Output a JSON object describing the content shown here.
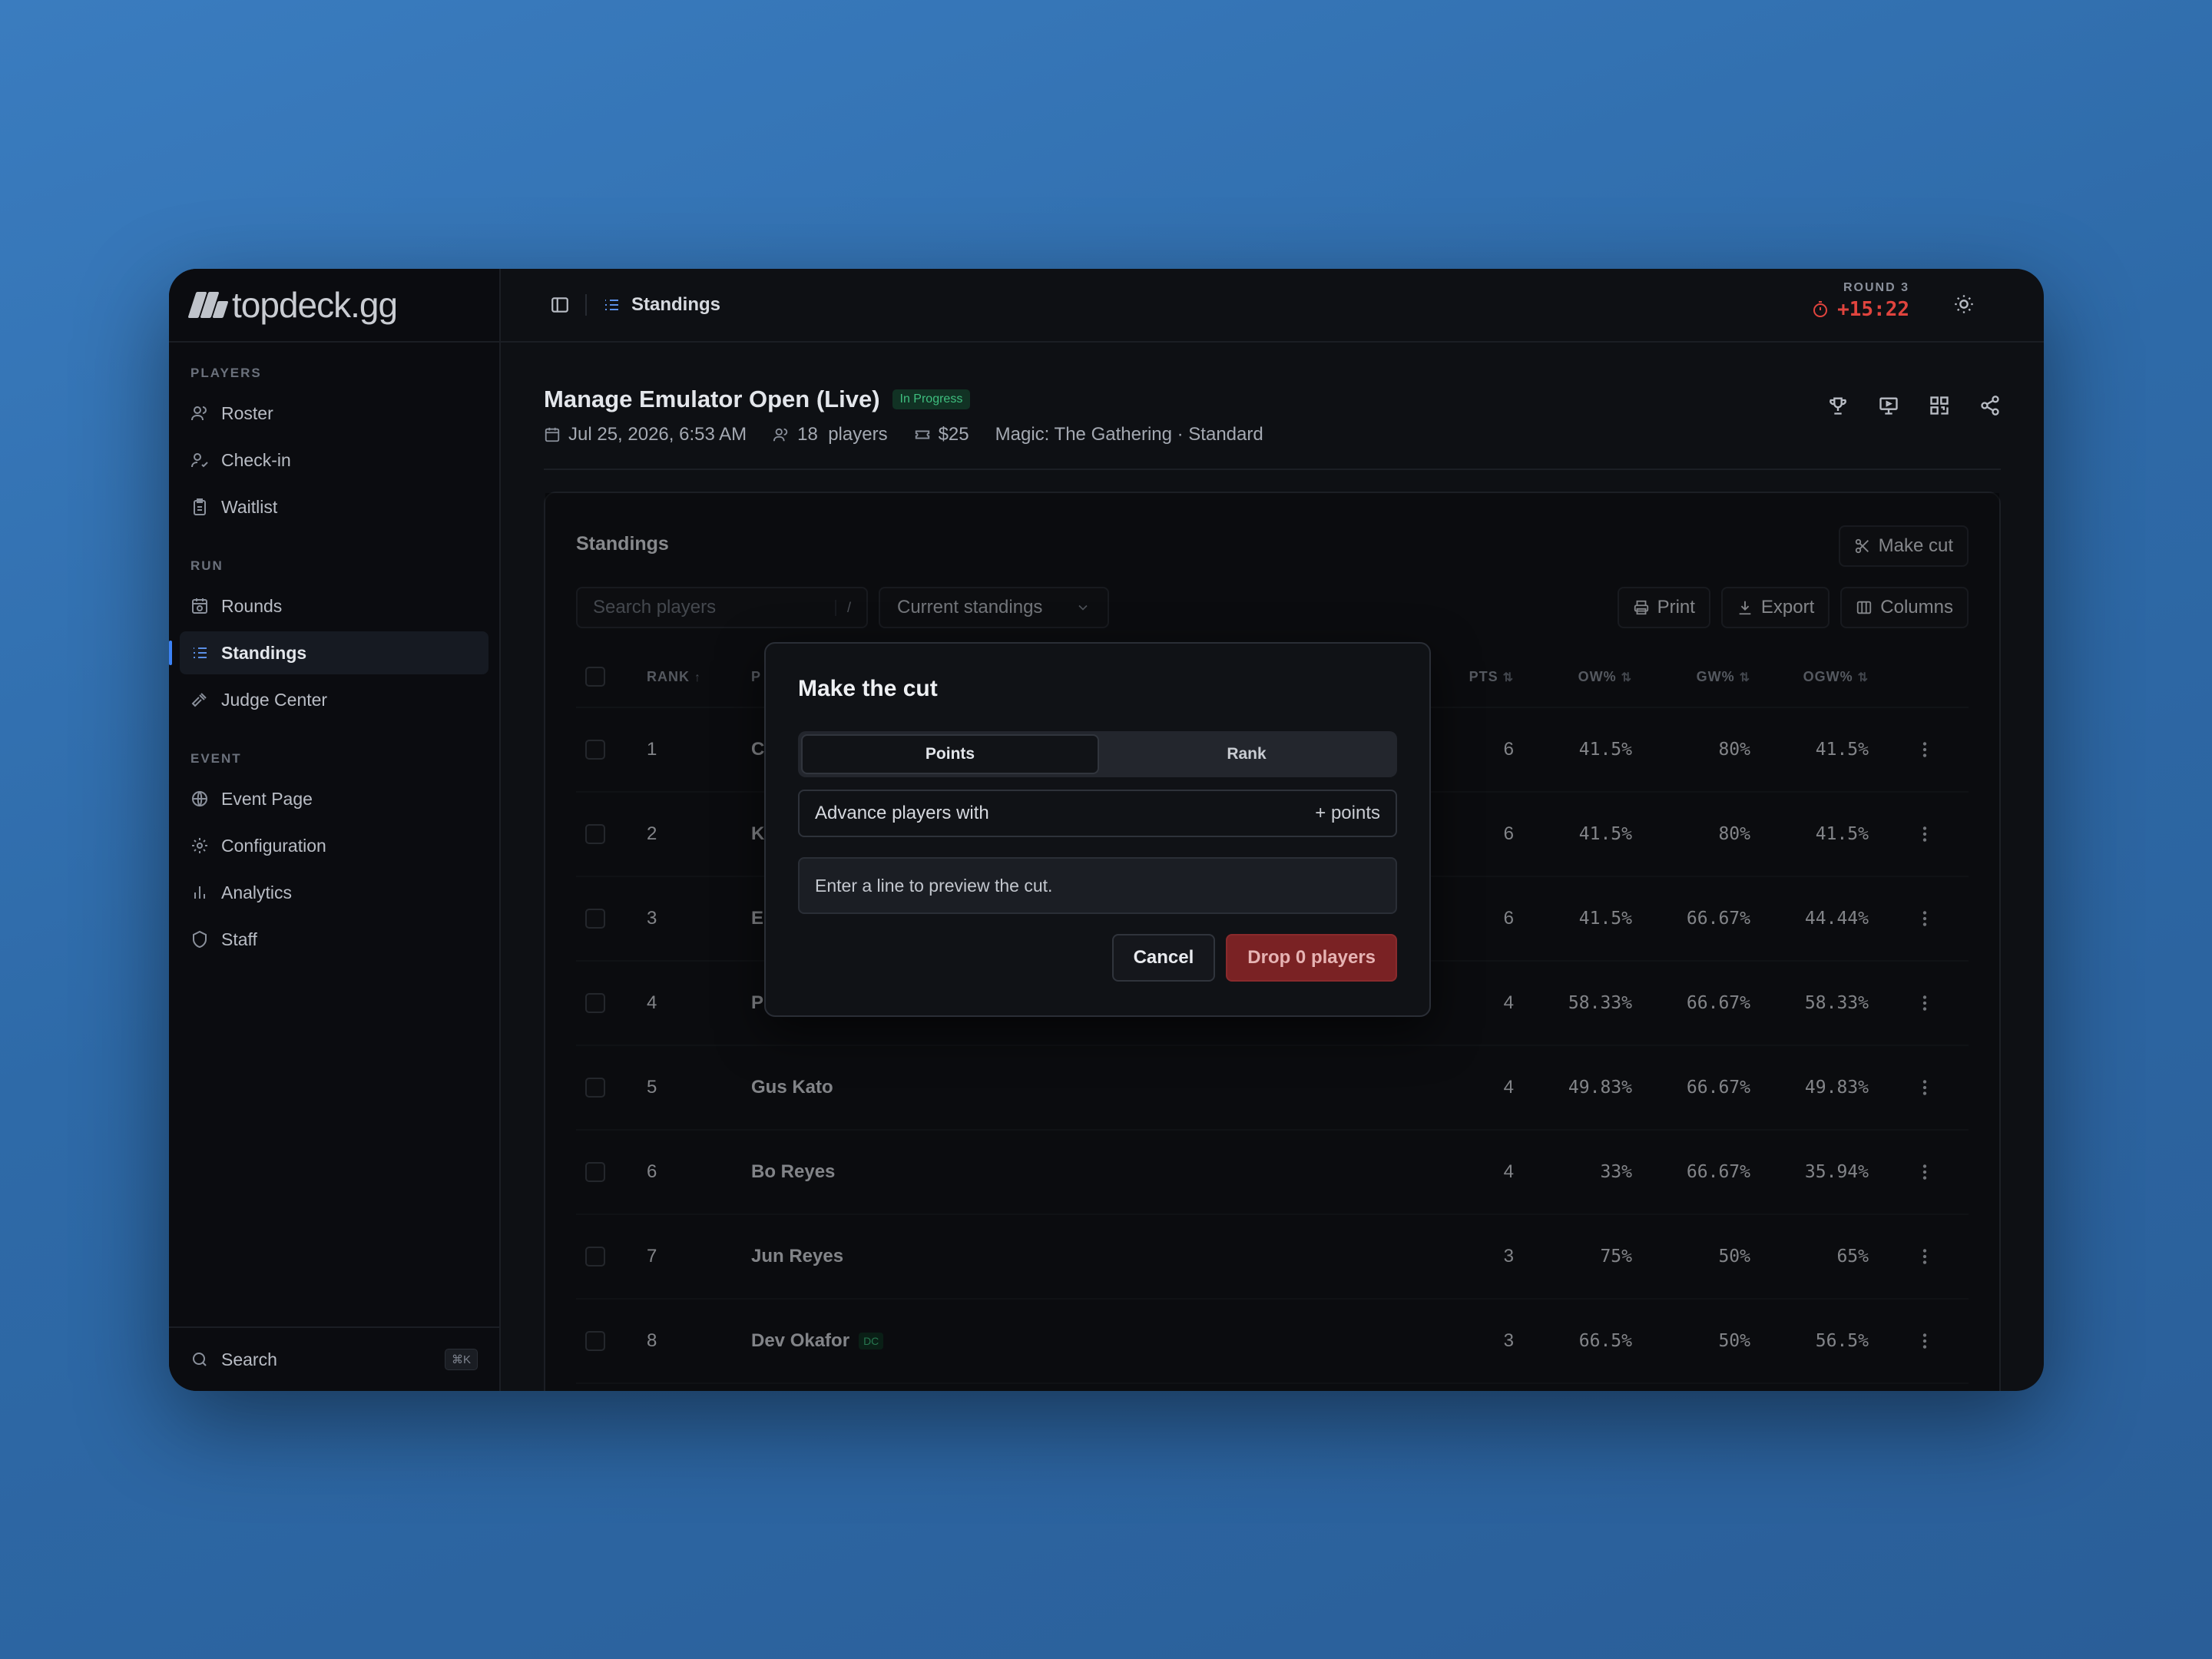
{
  "brand": {
    "name": "topdeck.gg"
  },
  "sidebar": {
    "sections": [
      {
        "label": "PLAYERS",
        "items": [
          {
            "label": "Roster",
            "icon": "users-icon"
          },
          {
            "label": "Check-in",
            "icon": "user-check-icon"
          },
          {
            "label": "Waitlist",
            "icon": "clipboard-icon"
          }
        ]
      },
      {
        "label": "RUN",
        "items": [
          {
            "label": "Rounds",
            "icon": "calendar-clock-icon"
          },
          {
            "label": "Standings",
            "icon": "list-ordered-icon",
            "active": true
          },
          {
            "label": "Judge Center",
            "icon": "gavel-icon"
          }
        ]
      },
      {
        "label": "EVENT",
        "items": [
          {
            "label": "Event Page",
            "icon": "globe-icon"
          },
          {
            "label": "Configuration",
            "icon": "gear-icon"
          },
          {
            "label": "Analytics",
            "icon": "bar-chart-icon"
          },
          {
            "label": "Staff",
            "icon": "shield-icon"
          }
        ]
      }
    ],
    "search": {
      "label": "Search",
      "shortcut": "⌘K"
    }
  },
  "topbar": {
    "breadcrumb": "Standings",
    "round": {
      "label": "ROUND 3",
      "timer": "+15:22"
    }
  },
  "event": {
    "title": "Manage Emulator Open (Live)",
    "status": "In Progress",
    "date": "Jul 25, 2026, 6:53 AM",
    "players": "18  players",
    "fee": "$25",
    "format": "Magic: The Gathering · Standard"
  },
  "standings": {
    "title": "Standings",
    "make_cut_label": "Make cut",
    "search_placeholder": "Search players",
    "search_shortcut": "/",
    "view_select": "Current standings",
    "print_label": "Print",
    "export_label": "Export",
    "columns_label": "Columns",
    "headers": {
      "rank": "RANK",
      "player": "P",
      "pts": "PTS",
      "ow": "OW%",
      "gw": "GW%",
      "ogw": "OGW%"
    },
    "rows": [
      {
        "rank": "1",
        "player": "C",
        "badge": "",
        "pts": "6",
        "ow": "41.5%",
        "gw": "80%",
        "ogw": "41.5%"
      },
      {
        "rank": "2",
        "player": "K",
        "badge": "",
        "pts": "6",
        "ow": "41.5%",
        "gw": "80%",
        "ogw": "41.5%"
      },
      {
        "rank": "3",
        "player": "E",
        "badge": "",
        "pts": "6",
        "ow": "41.5%",
        "gw": "66.67%",
        "ogw": "44.44%"
      },
      {
        "rank": "4",
        "player": "P",
        "badge": "",
        "pts": "4",
        "ow": "58.33%",
        "gw": "66.67%",
        "ogw": "58.33%"
      },
      {
        "rank": "5",
        "player": "Gus Kato",
        "badge": "",
        "pts": "4",
        "ow": "49.83%",
        "gw": "66.67%",
        "ogw": "49.83%"
      },
      {
        "rank": "6",
        "player": "Bo Reyes",
        "badge": "",
        "pts": "4",
        "ow": "33%",
        "gw": "66.67%",
        "ogw": "35.94%"
      },
      {
        "rank": "7",
        "player": "Jun Reyes",
        "badge": "",
        "pts": "3",
        "ow": "75%",
        "gw": "50%",
        "ogw": "65%"
      },
      {
        "rank": "8",
        "player": "Dev Okafor",
        "badge": "DC",
        "pts": "3",
        "ow": "66.5%",
        "gw": "50%",
        "ogw": "56.5%"
      }
    ]
  },
  "modal": {
    "title": "Make the cut",
    "tabs": [
      "Points",
      "Rank"
    ],
    "active_tab": "Points",
    "field_label": "Advance players with",
    "field_suffix": "+ points",
    "preview_text": "Enter a line to preview the cut.",
    "cancel_label": "Cancel",
    "confirm_label": "Drop 0 players"
  },
  "colors": {
    "accent": "#3b82f6",
    "danger": "#e0443e",
    "success": "#3fbf7f",
    "drop_button": "#7a2224"
  }
}
